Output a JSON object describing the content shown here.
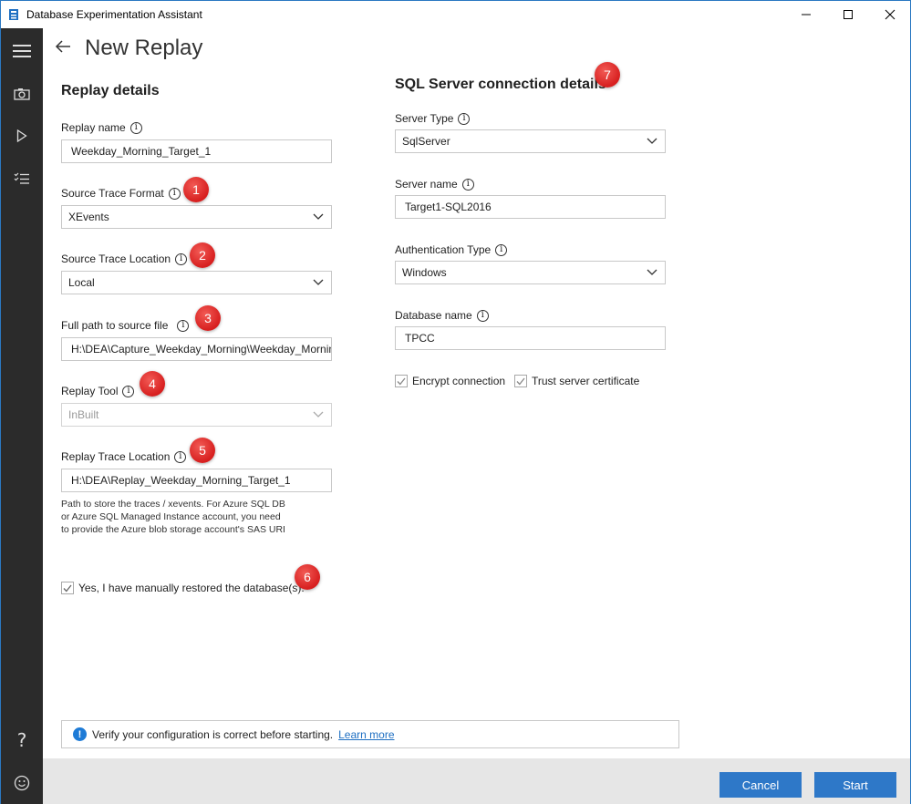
{
  "window": {
    "title": "Database Experimentation Assistant"
  },
  "sidebar": {
    "items": [
      {
        "name": "menu",
        "icon": "hamburger-icon"
      },
      {
        "name": "capture",
        "icon": "camera-icon"
      },
      {
        "name": "replay",
        "icon": "play-icon"
      },
      {
        "name": "analysis",
        "icon": "checklist-icon"
      }
    ],
    "bottom": [
      {
        "name": "help",
        "icon": "question-icon"
      },
      {
        "name": "feedback",
        "icon": "smiley-icon"
      }
    ]
  },
  "header": {
    "title": "New Replay"
  },
  "replay": {
    "title": "Replay details",
    "replay_name_label": "Replay name",
    "replay_name_value": "Weekday_Morning_Target_1",
    "trace_format_label": "Source Trace Format",
    "trace_format_value": "XEvents",
    "trace_location_label": "Source Trace Location",
    "trace_location_value": "Local",
    "full_path_label": "Full path to source file",
    "full_path_value": "H:\\DEA\\Capture_Weekday_Morning\\Weekday_Morning",
    "replay_tool_label": "Replay Tool",
    "replay_tool_value": "InBuilt",
    "replay_trace_location_label": "Replay Trace Location",
    "replay_trace_location_value": "H:\\DEA\\Replay_Weekday_Morning_Target_1",
    "hint": "Path to store the traces / xevents. For Azure SQL DB or Azure SQL Managed Instance account, you need to provide the Azure blob storage account's SAS URI",
    "restored_label": "Yes, I have manually restored the database(s).",
    "restored_checked": true
  },
  "sql": {
    "title": "SQL Server connection details",
    "server_type_label": "Server Type",
    "server_type_value": "SqlServer",
    "server_name_label": "Server name",
    "server_name_value": "Target1-SQL2016",
    "auth_type_label": "Authentication Type",
    "auth_type_value": "Windows",
    "db_name_label": "Database name",
    "db_name_value": "TPCC",
    "encrypt_label": "Encrypt connection",
    "encrypt_checked": true,
    "trust_label": "Trust server certificate",
    "trust_checked": true
  },
  "badges": [
    "1",
    "2",
    "3",
    "4",
    "5",
    "6",
    "7"
  ],
  "notice": {
    "text": "Verify your configuration is correct before starting.",
    "link": "Learn more"
  },
  "footer": {
    "cancel": "Cancel",
    "start": "Start"
  },
  "colors": {
    "accent": "#2e78c8",
    "sidebar": "#2b2b2b",
    "badge": "#d71f1f",
    "footer": "#e6e6e6"
  }
}
